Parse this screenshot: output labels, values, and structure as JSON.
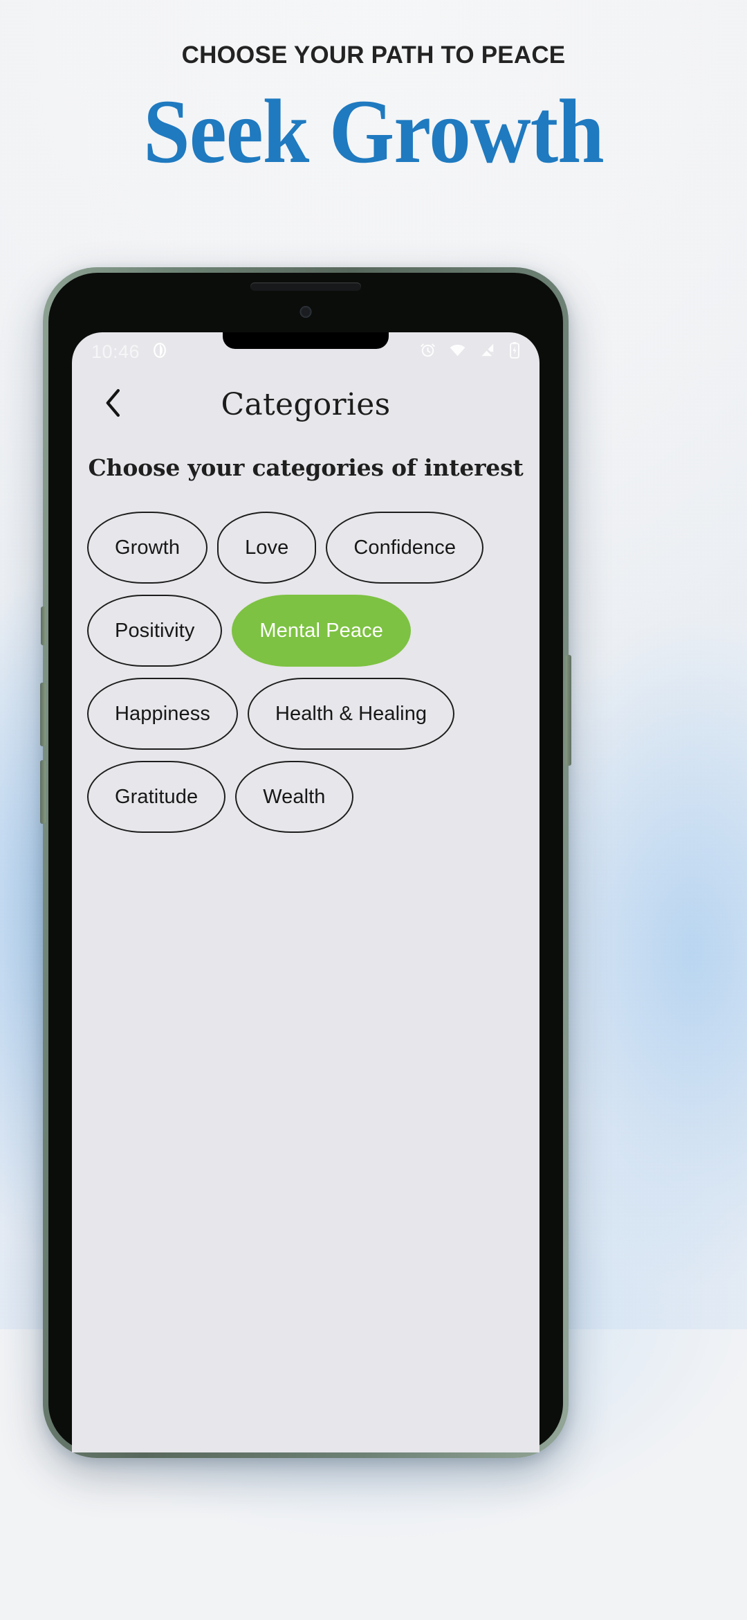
{
  "promo": {
    "eyebrow": "Choose your path to peace",
    "headline": "Seek Growth",
    "accent_color": "#1f7ac0",
    "eyebrow_color": "#232323"
  },
  "phone": {
    "frame_color": "#6f8476",
    "screen_bg": "#e7e6ea",
    "buttons": [
      {
        "name": "mute-switch"
      },
      {
        "name": "volume-down-button"
      },
      {
        "name": "volume-up-button"
      },
      {
        "name": "power-button"
      }
    ]
  },
  "status_bar": {
    "time": "10:46",
    "left_icons": [
      "camera-icon"
    ],
    "right_icons": [
      "alarm-icon",
      "wifi-icon",
      "cellular-signal-off-icon",
      "battery-charging-icon"
    ]
  },
  "app": {
    "back_icon": "chevron-left-icon",
    "title": "Categories",
    "subtitle": "Choose your categories of interest",
    "selected_color": "#7dc242",
    "categories": [
      {
        "label": "Growth",
        "selected": false
      },
      {
        "label": "Love",
        "selected": false
      },
      {
        "label": "Confidence",
        "selected": false
      },
      {
        "label": "Positivity",
        "selected": false
      },
      {
        "label": "Mental Peace",
        "selected": true
      },
      {
        "label": "Happiness",
        "selected": false
      },
      {
        "label": "Health & Healing",
        "selected": false
      },
      {
        "label": "Gratitude",
        "selected": false
      },
      {
        "label": "Wealth",
        "selected": false
      }
    ]
  }
}
